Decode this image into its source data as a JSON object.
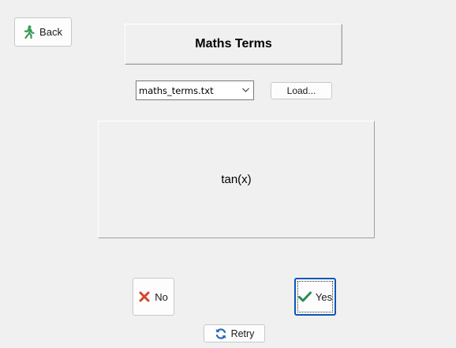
{
  "header": {
    "back_label": "Back",
    "title": "Maths Terms"
  },
  "file": {
    "selected": "maths_terms.txt",
    "load_label": "Load..."
  },
  "term": {
    "text": "tan(x)"
  },
  "answers": {
    "no_label": "No",
    "yes_label": "Yes",
    "retry_label": "Retry"
  },
  "icons": {
    "back": "walking-person-icon",
    "no": "cross-icon",
    "yes": "check-icon",
    "retry": "refresh-icon",
    "dropdown": "chevron-down-icon"
  },
  "colors": {
    "back_icon": "#3a9a5a",
    "no_icon": "#d8442a",
    "yes_icon": "#2e8b57",
    "retry_icon": "#2a6ab8",
    "focus_border": "#0a56b8"
  }
}
